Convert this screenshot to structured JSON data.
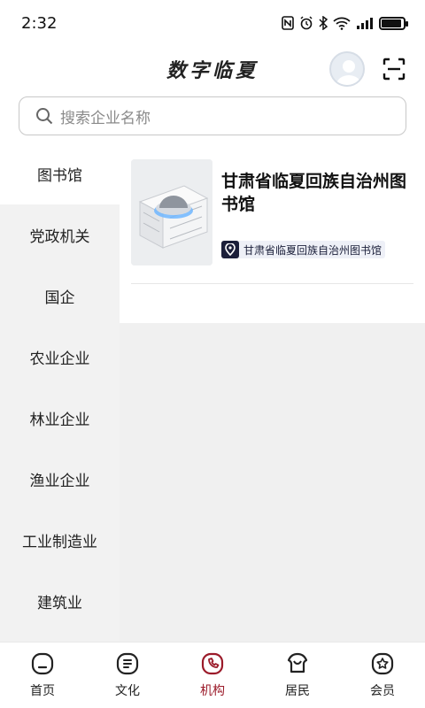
{
  "status_bar": {
    "time": "2:32",
    "icons": [
      "nfc-icon",
      "alarm-icon",
      "bluetooth-icon",
      "wifi-icon",
      "signal-icon",
      "battery-icon"
    ],
    "battery_level": 0.9
  },
  "header": {
    "title": "数字临夏"
  },
  "search": {
    "placeholder": "搜索企业名称"
  },
  "sidebar": {
    "items": [
      {
        "label": "图书馆",
        "active": true
      },
      {
        "label": "党政机关",
        "active": false
      },
      {
        "label": "国企",
        "active": false
      },
      {
        "label": "农业企业",
        "active": false
      },
      {
        "label": "林业企业",
        "active": false
      },
      {
        "label": "渔业企业",
        "active": false
      },
      {
        "label": "工业制造业",
        "active": false
      },
      {
        "label": "建筑业",
        "active": false
      }
    ]
  },
  "content": {
    "cards": [
      {
        "title": "甘肃省临夏回族自治州图书馆",
        "location_tag": "甘肃省临夏回族自治州图书馆"
      }
    ]
  },
  "tab_bar": {
    "tabs": [
      {
        "label": "首页",
        "icon": "home-icon",
        "active": false
      },
      {
        "label": "文化",
        "icon": "document-icon",
        "active": false
      },
      {
        "label": "机构",
        "icon": "phone-icon",
        "active": true
      },
      {
        "label": "居民",
        "icon": "residents-icon",
        "active": false
      },
      {
        "label": "会员",
        "icon": "member-icon",
        "active": false
      }
    ],
    "active_color": "#9b1b2a",
    "inactive_color": "#222222"
  }
}
